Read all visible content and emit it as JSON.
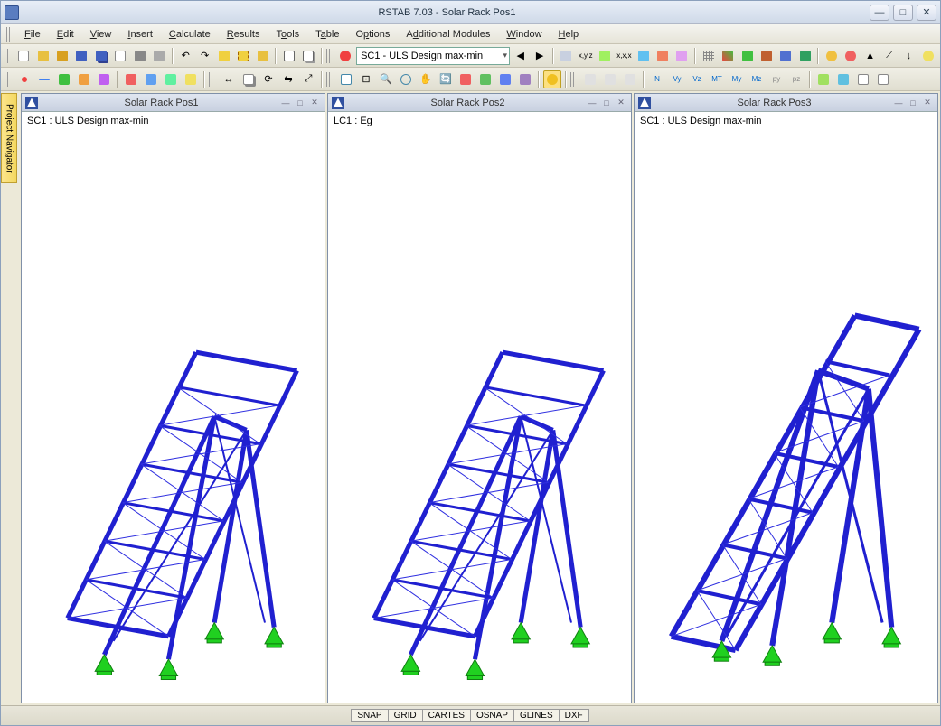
{
  "app": {
    "title": "RSTAB 7.03 - Solar Rack Pos1"
  },
  "menu": {
    "file": "File",
    "edit": "Edit",
    "view": "View",
    "insert": "Insert",
    "calculate": "Calculate",
    "results": "Results",
    "tools": "Tools",
    "table": "Table",
    "options": "Options",
    "modules": "Additional Modules",
    "window": "Window",
    "help": "Help"
  },
  "toolbar": {
    "dropdown_value": "SC1 - ULS Design max-min"
  },
  "sidebar": {
    "navigator": "Project Navigator"
  },
  "views": [
    {
      "title": "Solar Rack Pos1",
      "loadcase": "SC1 : ULS Design max-min"
    },
    {
      "title": "Solar Rack Pos2",
      "loadcase": "LC1 : Eg"
    },
    {
      "title": "Solar Rack Pos3",
      "loadcase": "SC1 : ULS Design max-min"
    }
  ],
  "status": {
    "snap": "SNAP",
    "grid": "GRID",
    "cartes": "CARTES",
    "osnap": "OSNAP",
    "glines": "GLINES",
    "dxf": "DXF"
  }
}
